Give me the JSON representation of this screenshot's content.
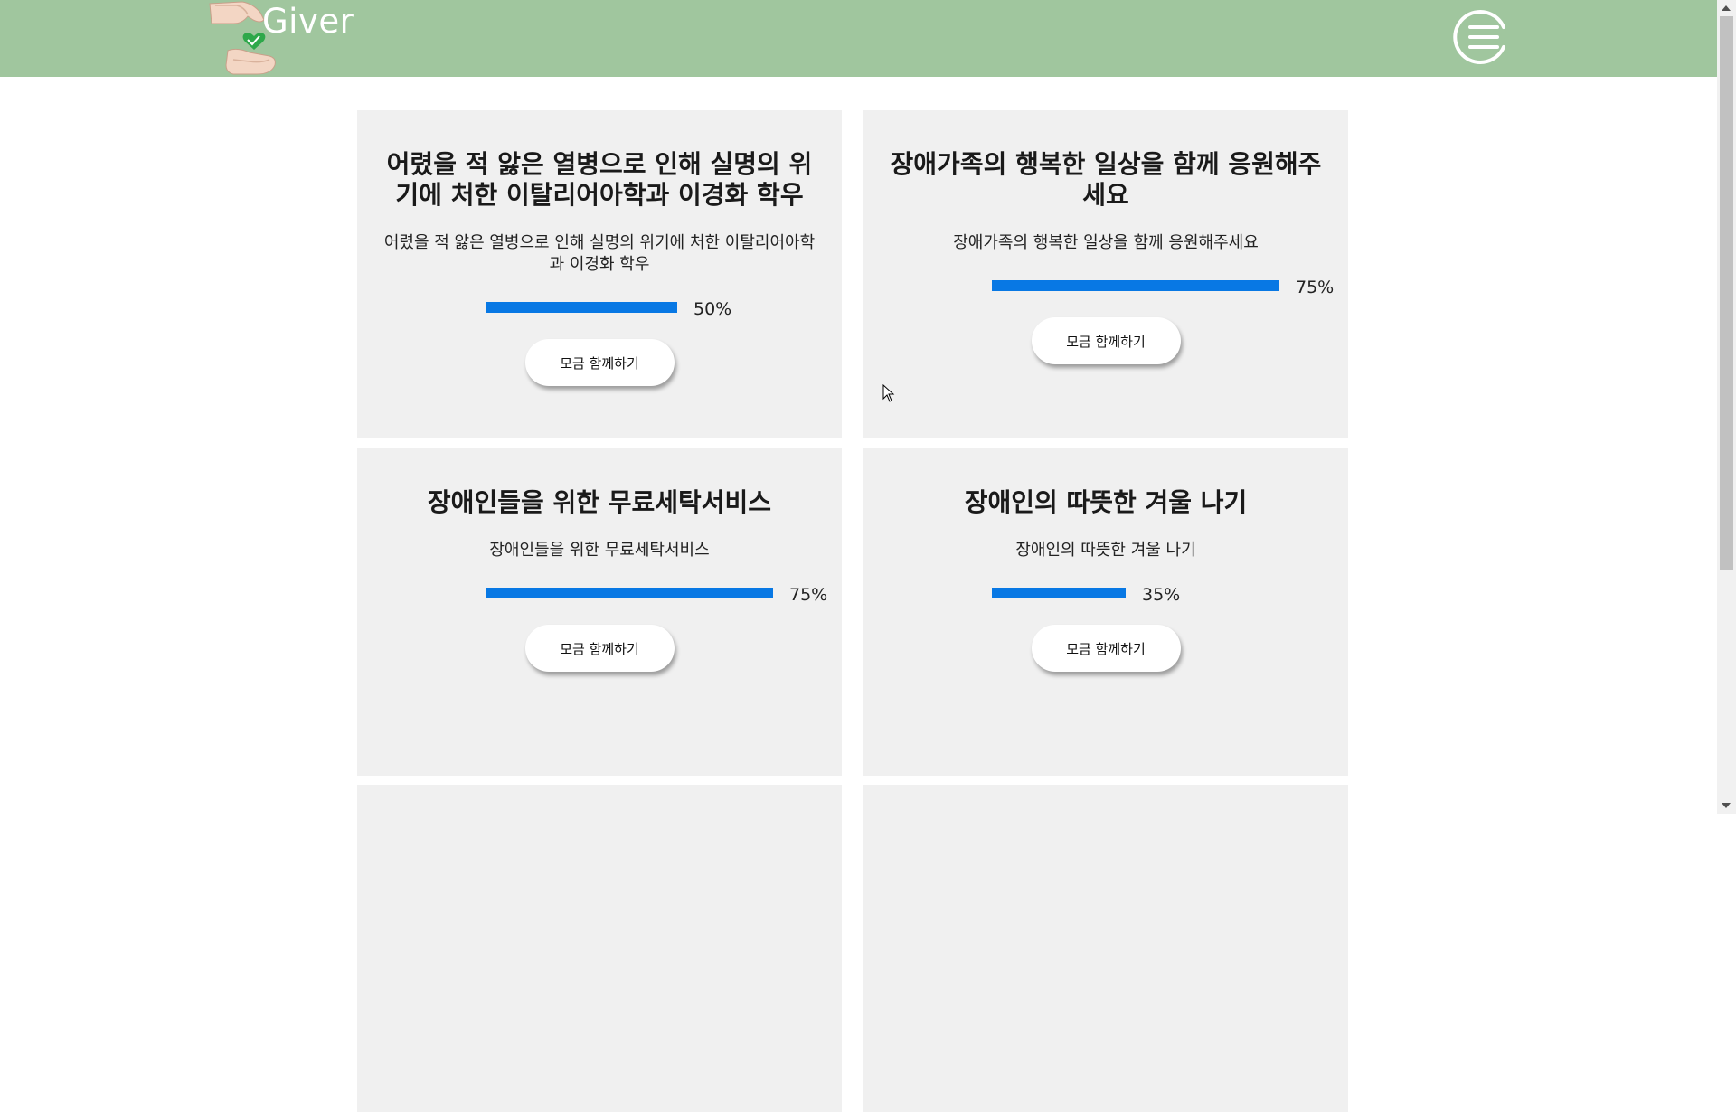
{
  "header": {
    "logo_text": "Giver",
    "colors": {
      "background": "#a0c69e",
      "logo_text": "#ffffff"
    },
    "menu_icon": "menu-circle-icon"
  },
  "cards": [
    {
      "title": "어렸을 적 앓은 열병으로 인해 실명의 위기에 처한 이탈리어아학과 이경화 학우",
      "description": "어렸을 적 앓은 열병으로 인해 실명의 위기에 처한 이탈리어아학과 이경화 학우",
      "progress": 50,
      "progress_label": "50%",
      "button_label": "모금 함께하기"
    },
    {
      "title": "장애가족의 행복한 일상을 함께 응원해주세요",
      "description": "장애가족의 행복한 일상을 함께 응원해주세요",
      "progress": 75,
      "progress_label": "75%",
      "button_label": "모금 함께하기"
    },
    {
      "title": "장애인들을 위한 무료세탁서비스",
      "description": "장애인들을 위한 무료세탁서비스",
      "progress": 75,
      "progress_label": "75%",
      "button_label": "모금 함께하기"
    },
    {
      "title": "장애인의 따뜻한 겨울 나기",
      "description": "장애인의 따뜻한 겨울 나기",
      "progress": 35,
      "progress_label": "35%",
      "button_label": "모금 함께하기"
    }
  ],
  "colors": {
    "card_background": "#f0f0f0",
    "progress_fill": "#0878e4"
  }
}
